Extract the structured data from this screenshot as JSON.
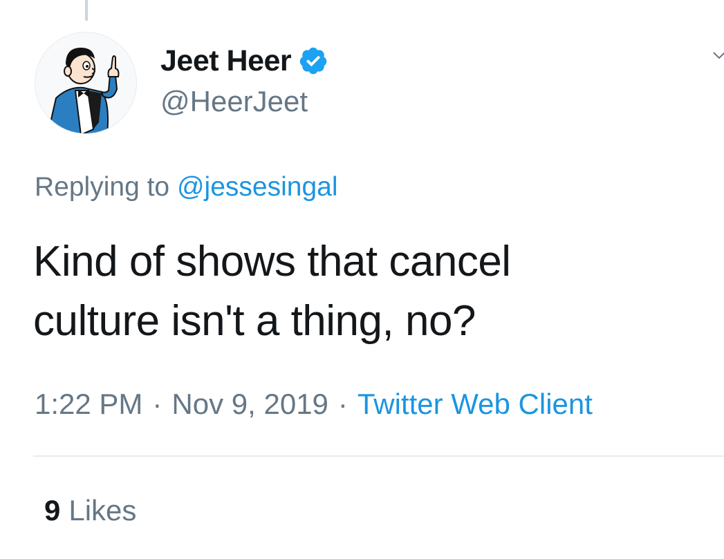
{
  "tweet": {
    "author": {
      "name": "Jeet Heer",
      "handle": "@HeerJeet",
      "verified": true,
      "avatar_icon": "cartoon-man-pointing-avatar"
    },
    "reply_context": {
      "prefix": "Replying to",
      "mention": "@jessesingal"
    },
    "text_lines": [
      "Kind of shows that cancel",
      "culture isn't a thing, no?"
    ],
    "meta": {
      "time": "1:22 PM",
      "separator": "·",
      "date": "Nov 9, 2019",
      "source": "Twitter Web Client"
    },
    "stats": {
      "likes_count": "9",
      "likes_label": "Likes"
    }
  },
  "colors": {
    "text_primary": "#14171a",
    "text_secondary": "#657786",
    "link": "#1b95e0",
    "verified_badge": "#1da1f2",
    "divider": "#e6ecf0"
  },
  "icons": {
    "verified": "verified-badge-icon",
    "more": "chevron-down-icon"
  }
}
